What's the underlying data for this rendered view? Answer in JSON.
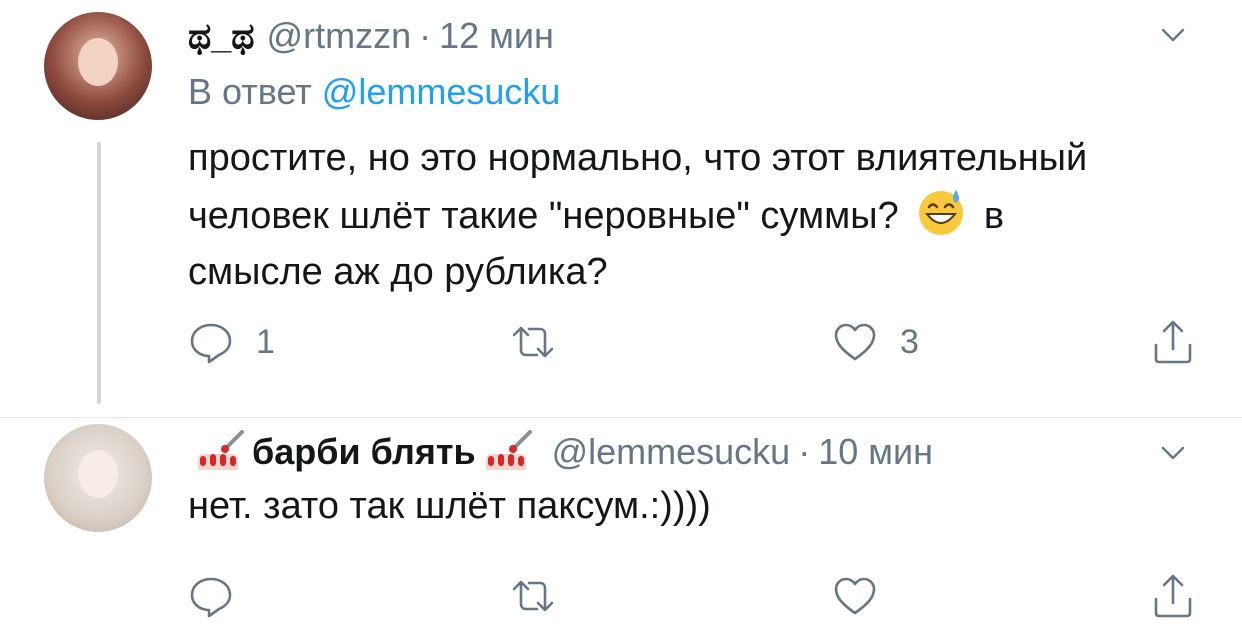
{
  "colors": {
    "text": "#14171a",
    "secondary": "#657786",
    "link": "#1da1f2",
    "thread_line": "#ccd6dd",
    "divider": "#e1e8ed"
  },
  "tweets": [
    {
      "author_name": "ಥ_ಥ",
      "handle": "@rtmzzn",
      "separator": "·",
      "time": "12 мин",
      "reply_prefix": "В ответ",
      "reply_mention": "@lemmesucku",
      "text_part1": "простите, но это нормально, что этот влиятельный человек шлёт такие \"неровные\" суммы?",
      "emoji_icon": "grinning-sweat-emoji",
      "text_part2": "в смысле аж до рублика?",
      "reply_count": "1",
      "retweet_count": "",
      "like_count": "3"
    },
    {
      "author_name": "барби блять",
      "name_decoration_icon": "nail-polish-emoji",
      "handle": "@lemmesucku",
      "separator": "·",
      "time": "10 мин",
      "text": "нет. зато так шлёт паксум.:))))",
      "reply_count": "",
      "retweet_count": "",
      "like_count": ""
    }
  ]
}
